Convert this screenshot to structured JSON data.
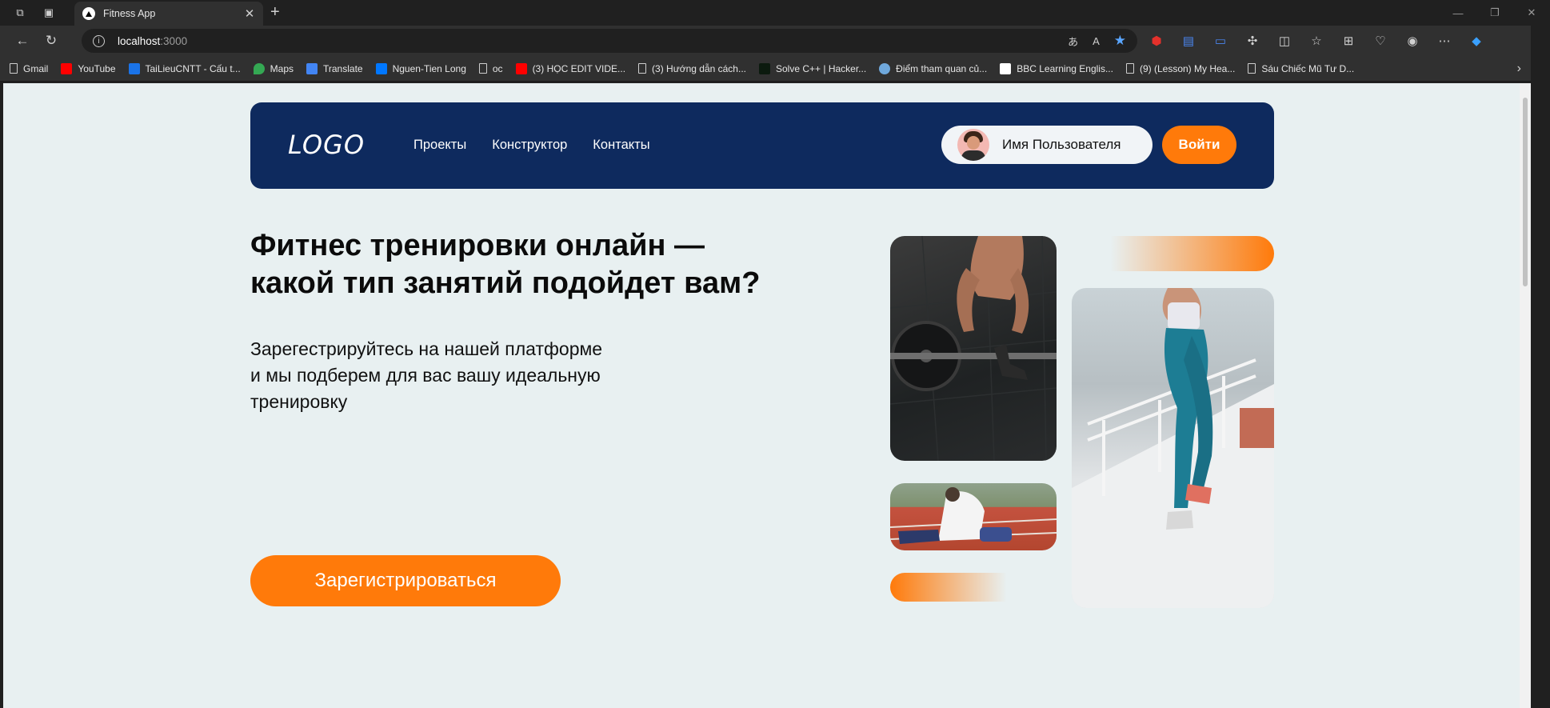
{
  "browser": {
    "tab_title": "Fitness App",
    "url_host": "localhost",
    "url_port": ":3000",
    "bookmarks": [
      {
        "label": "Gmail",
        "icon": "page-icon"
      },
      {
        "label": "YouTube",
        "icon": "youtube-icon"
      },
      {
        "label": "TaiLieuCNTT - Cấu t...",
        "icon": "site-icon"
      },
      {
        "label": "Maps",
        "icon": "maps-icon"
      },
      {
        "label": "Translate",
        "icon": "translate-icon"
      },
      {
        "label": "Nguen-Tien Long",
        "icon": "vk-icon"
      },
      {
        "label": "oc",
        "icon": "page-icon"
      },
      {
        "label": "(3) HỌC EDIT VIDE...",
        "icon": "youtube-icon"
      },
      {
        "label": "(3) Hướng dẫn cách...",
        "icon": "page-icon"
      },
      {
        "label": "Solve C++ | Hacker...",
        "icon": "hackerrank-icon"
      },
      {
        "label": "Điểm tham quan củ...",
        "icon": "globe-icon"
      },
      {
        "label": "BBC Learning Englis...",
        "icon": "bbc-icon"
      },
      {
        "label": "(9) (Lesson) My Hea...",
        "icon": "page-icon"
      },
      {
        "label": "Sáu Chiếc Mũ Tư D...",
        "icon": "page-icon"
      }
    ]
  },
  "site": {
    "logo": "LOGO",
    "nav": [
      "Проекты",
      "Конструктор",
      "Контакты"
    ],
    "user_name": "Имя Пользователя",
    "login_label": "Войти",
    "hero_title_line1": "Фитнес тренировки онлайн —",
    "hero_title_line2": "какой тип занятий подойдет вам?",
    "hero_text_line1": "Зарегестрируйтесь на нашей платформе",
    "hero_text_line2": "и мы подберем для вас вашу идеальную",
    "hero_text_line3": "тренировку",
    "cta_label": "Зарегистрироваться"
  },
  "colors": {
    "header_bg": "#0e2a5e",
    "accent": "#ff7a0a",
    "page_bg": "#e8f0f1"
  }
}
